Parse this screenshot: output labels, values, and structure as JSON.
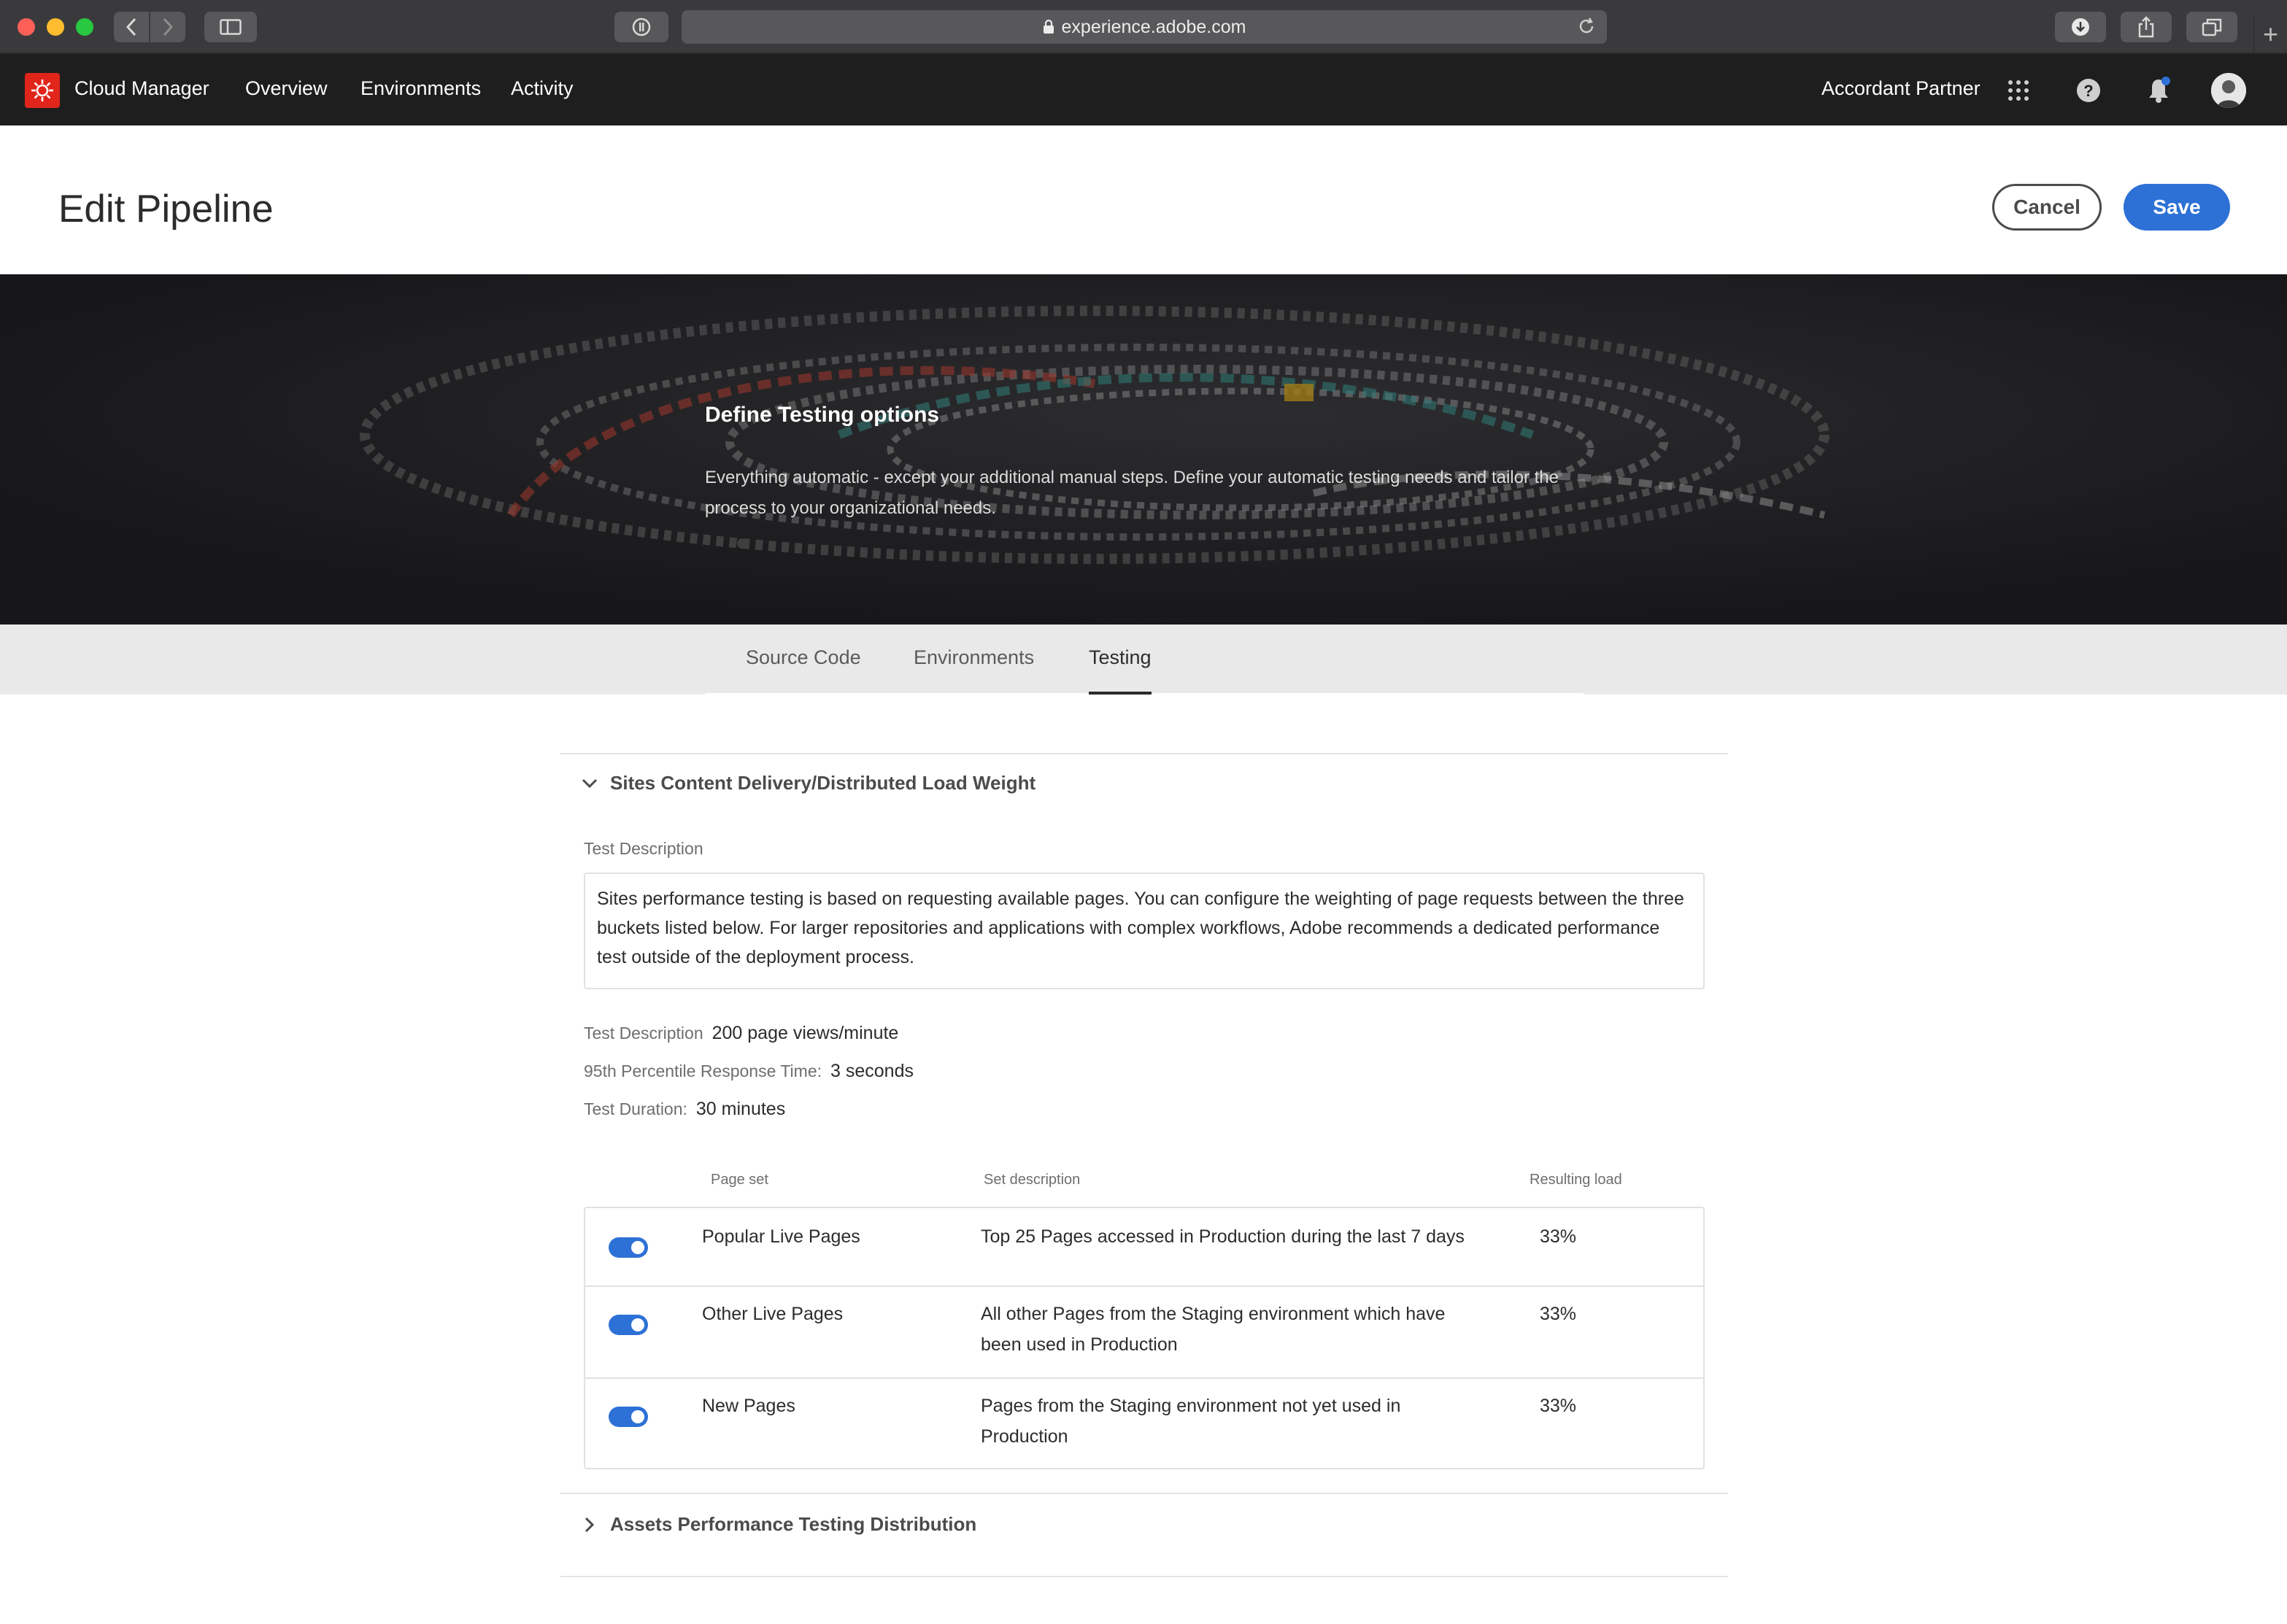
{
  "browser": {
    "url": "experience.adobe.com"
  },
  "appbar": {
    "title": "Cloud Manager",
    "nav": [
      "Overview",
      "Environments",
      "Activity"
    ],
    "org": "Accordant Partner"
  },
  "page": {
    "title": "Edit Pipeline",
    "cancel_label": "Cancel",
    "save_label": "Save"
  },
  "hero": {
    "title": "Define Testing options",
    "description": "Everything automatic - except your additional manual steps. Define your automatic testing needs and tailor the process to your organizational needs."
  },
  "tabs": [
    {
      "label": "Source Code",
      "active": false
    },
    {
      "label": "Environments",
      "active": false
    },
    {
      "label": "Testing",
      "active": true
    }
  ],
  "sites_section": {
    "title": "Sites Content Delivery/Distributed Load Weight",
    "expanded": true,
    "test_description_label": "Test Description",
    "test_description": "Sites performance testing is based on requesting available pages. You can configure the weighting of page requests between the three buckets listed below. For larger repositories and applications with complex workflows, Adobe recommends a dedicated performance test outside of the deployment process.",
    "metrics": [
      {
        "label": "Test Description",
        "value": "200 page views/minute"
      },
      {
        "label": "95th Percentile Response Time:",
        "value": "3 seconds"
      },
      {
        "label": "Test Duration:",
        "value": "30 minutes"
      }
    ],
    "table": {
      "headers": [
        "Page set",
        "Set description",
        "Resulting load"
      ],
      "rows": [
        {
          "enabled": true,
          "page_set": "Popular Live Pages",
          "description": "Top 25 Pages accessed in Production during the last 7 days",
          "load": "33%"
        },
        {
          "enabled": true,
          "page_set": "Other Live Pages",
          "description": "All other Pages from the Staging environment which have been used in Production",
          "load": "33%"
        },
        {
          "enabled": true,
          "page_set": "New Pages",
          "description": "Pages from the Staging environment not yet used in Production",
          "load": "33%"
        }
      ]
    }
  },
  "assets_section": {
    "title": "Assets Performance Testing Distribution",
    "expanded": false
  },
  "colors": {
    "accent": "#2d71d6",
    "appbar": "#1e1e1e",
    "brand_logo": "#e1251b",
    "tab_band": "#e9e9e9"
  },
  "icons": [
    "chevron-left-icon",
    "chevron-right-icon",
    "sidebar-icon",
    "password-icon",
    "lock-icon",
    "reload-icon",
    "download-icon",
    "share-icon",
    "tabs-icon",
    "plus-icon",
    "adobe-cloud-manager-logo",
    "apps-grid-icon",
    "help-icon",
    "bell-icon",
    "avatar",
    "chevron-down-icon",
    "chevron-right-icon"
  ]
}
